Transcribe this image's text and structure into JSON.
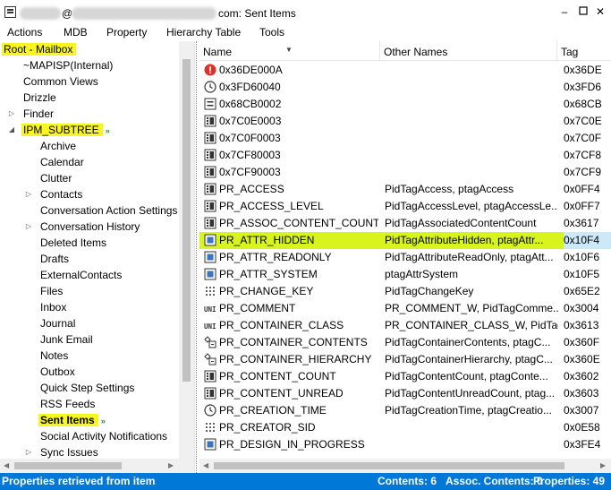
{
  "window": {
    "title_prefix": "@",
    "title_suffix": "com: Sent Items"
  },
  "menu": [
    "Actions",
    "MDB",
    "Property",
    "Hierarchy Table",
    "Tools"
  ],
  "tree": {
    "root": "Root - Mailbox",
    "items": [
      {
        "label": "~MAPISP(Internal)",
        "level": 1,
        "expander": ""
      },
      {
        "label": "Common Views",
        "level": 1,
        "expander": ""
      },
      {
        "label": "Drizzle",
        "level": 1,
        "expander": ""
      },
      {
        "label": "Finder",
        "level": 1,
        "expander": "collapsed"
      },
      {
        "label": "IPM_SUBTREE",
        "level": 1,
        "expander": "expanded",
        "highlight": true,
        "sync": true
      },
      {
        "label": "Archive",
        "level": 2,
        "expander": ""
      },
      {
        "label": "Calendar",
        "level": 2,
        "expander": ""
      },
      {
        "label": "Clutter",
        "level": 2,
        "expander": ""
      },
      {
        "label": "Contacts",
        "level": 2,
        "expander": "collapsed"
      },
      {
        "label": "Conversation Action Settings",
        "level": 2,
        "expander": ""
      },
      {
        "label": "Conversation History",
        "level": 2,
        "expander": "collapsed"
      },
      {
        "label": "Deleted Items",
        "level": 2,
        "expander": ""
      },
      {
        "label": "Drafts",
        "level": 2,
        "expander": ""
      },
      {
        "label": "ExternalContacts",
        "level": 2,
        "expander": ""
      },
      {
        "label": "Files",
        "level": 2,
        "expander": ""
      },
      {
        "label": "Inbox",
        "level": 2,
        "expander": ""
      },
      {
        "label": "Journal",
        "level": 2,
        "expander": ""
      },
      {
        "label": "Junk Email",
        "level": 2,
        "expander": ""
      },
      {
        "label": "Notes",
        "level": 2,
        "expander": ""
      },
      {
        "label": "Outbox",
        "level": 2,
        "expander": ""
      },
      {
        "label": "Quick Step Settings",
        "level": 2,
        "expander": ""
      },
      {
        "label": "RSS Feeds",
        "level": 2,
        "expander": ""
      },
      {
        "label": "Sent Items",
        "level": 2,
        "expander": "",
        "highlight": true,
        "bold": true,
        "sync": true
      },
      {
        "label": "Social Activity Notifications",
        "level": 2,
        "expander": ""
      },
      {
        "label": "Sync Issues",
        "level": 2,
        "expander": "collapsed"
      }
    ]
  },
  "columns": {
    "name": "Name",
    "other": "Other Names",
    "tag": "Tag"
  },
  "rows": [
    {
      "icon": "error-icon",
      "name": "0x36DE000A",
      "other": "",
      "tag": "0x36DE"
    },
    {
      "icon": "clock-icon",
      "name": "0x3FD60040",
      "other": "",
      "tag": "0x3FD6"
    },
    {
      "icon": "binary-icon",
      "name": "0x68CB0002",
      "other": "",
      "tag": "0x68CB"
    },
    {
      "icon": "multi-binary-icon",
      "name": "0x7C0E0003",
      "other": "",
      "tag": "0x7C0E"
    },
    {
      "icon": "multi-binary-icon",
      "name": "0x7C0F0003",
      "other": "",
      "tag": "0x7C0F"
    },
    {
      "icon": "multi-binary-icon",
      "name": "0x7CF80003",
      "other": "",
      "tag": "0x7CF8"
    },
    {
      "icon": "multi-binary-icon",
      "name": "0x7CF90003",
      "other": "",
      "tag": "0x7CF9"
    },
    {
      "icon": "multi-binary-icon",
      "name": "PR_ACCESS",
      "other": "PidTagAccess, ptagAccess",
      "tag": "0x0FF4"
    },
    {
      "icon": "multi-binary-icon",
      "name": "PR_ACCESS_LEVEL",
      "other": "PidTagAccessLevel, ptagAccessLe...",
      "tag": "0x0FF7"
    },
    {
      "icon": "multi-binary-icon",
      "name": "PR_ASSOC_CONTENT_COUNT",
      "other": "PidTagAssociatedContentCount",
      "tag": "0x3617"
    },
    {
      "icon": "boolean-icon",
      "name": "PR_ATTR_HIDDEN",
      "other": "PidTagAttributeHidden, ptagAttr...",
      "tag": "0x10F4",
      "highlight": true
    },
    {
      "icon": "boolean-icon",
      "name": "PR_ATTR_READONLY",
      "other": "PidTagAttributeReadOnly, ptagAtt...",
      "tag": "0x10F6"
    },
    {
      "icon": "boolean-icon",
      "name": "PR_ATTR_SYSTEM",
      "other": "ptagAttrSystem",
      "tag": "0x10F5"
    },
    {
      "icon": "binary-dots-icon",
      "name": "PR_CHANGE_KEY",
      "other": "PidTagChangeKey",
      "tag": "0x65E2"
    },
    {
      "icon": "unicode-icon",
      "name": "PR_COMMENT",
      "other": "PR_COMMENT_W, PidTagComme...",
      "tag": "0x3004"
    },
    {
      "icon": "unicode-icon",
      "name": "PR_CONTAINER_CLASS",
      "other": "PR_CONTAINER_CLASS_W, PidTag...",
      "tag": "0x3613"
    },
    {
      "icon": "object-icon",
      "name": "PR_CONTAINER_CONTENTS",
      "other": "PidTagContainerContents, ptagC...",
      "tag": "0x360F"
    },
    {
      "icon": "object-icon",
      "name": "PR_CONTAINER_HIERARCHY",
      "other": "PidTagContainerHierarchy, ptagC...",
      "tag": "0x360E"
    },
    {
      "icon": "multi-binary-icon",
      "name": "PR_CONTENT_COUNT",
      "other": "PidTagContentCount, ptagConte...",
      "tag": "0x3602"
    },
    {
      "icon": "multi-binary-icon",
      "name": "PR_CONTENT_UNREAD",
      "other": "PidTagContentUnreadCount, ptag...",
      "tag": "0x3603"
    },
    {
      "icon": "clock-icon",
      "name": "PR_CREATION_TIME",
      "other": "PidTagCreationTime, ptagCreatio...",
      "tag": "0x3007"
    },
    {
      "icon": "binary-dots-icon",
      "name": "PR_CREATOR_SID",
      "other": "",
      "tag": "0x0E58"
    },
    {
      "icon": "boolean-icon",
      "name": "PR_DESIGN_IN_PROGRESS",
      "other": "",
      "tag": "0x3FE4"
    }
  ],
  "status": {
    "left": "Properties retrieved from item",
    "contents": "Contents: 6",
    "assoc": "Assoc. Contents: 0",
    "properties": "Properties: 49"
  },
  "colors": {
    "accent": "#0078d7",
    "highlight_yellow": "#f9f51f",
    "highlight_row": "#d8f41f"
  }
}
